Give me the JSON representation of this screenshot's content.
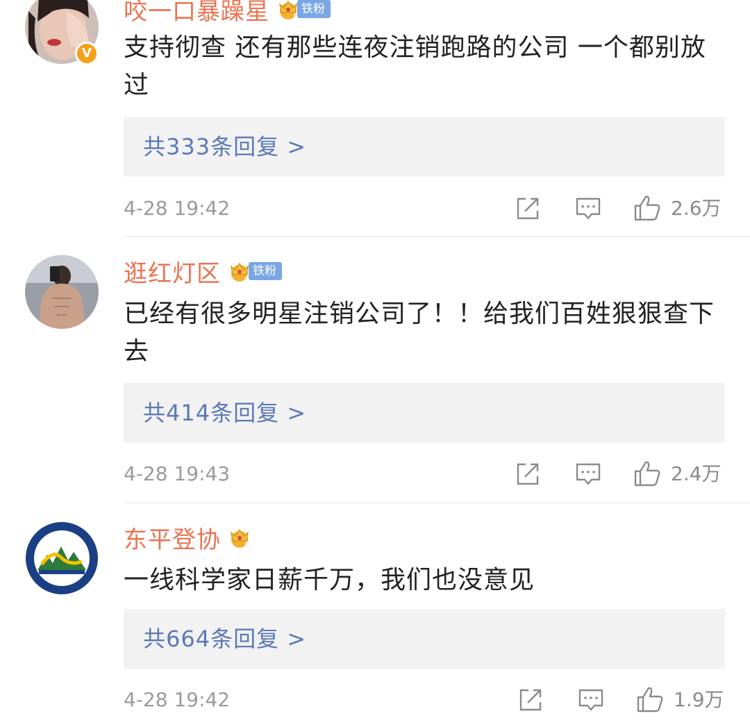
{
  "comments": [
    {
      "username": "咬一口暴躁星",
      "crown_level": "5",
      "fan_badge": "铁粉",
      "verified_mark": "V",
      "text": "支持彻查 还有那些连夜注销跑路的公司 一个都别放过",
      "reply_label": "共333条回复 >",
      "time": "4-28 19:42",
      "likes": "2.6万"
    },
    {
      "username": "逛红灯区",
      "crown_level": "4",
      "fan_badge": "铁粉",
      "text": "已经有很多明星注销公司了！！给我们百姓狠狠查下去",
      "reply_label": "共414条回复 >",
      "time": "4-28 19:43",
      "likes": "2.4万"
    },
    {
      "username": "东平登协",
      "crown_level": "6",
      "text": "一线科学家日薪千万，我们也没意见",
      "reply_label": "共664条回复 >",
      "time": "4-28 19:42",
      "likes": "1.9万"
    }
  ],
  "icons": {
    "share": "share-icon",
    "comment": "comment-icon",
    "like": "thumbs-up-icon"
  },
  "colors": {
    "username": "#eb7350",
    "reply_link": "#5b79b6",
    "reply_bg": "#f2f2f2",
    "meta": "#9a9a9a",
    "crown": "#f2b12d",
    "fan_badge": "#7aa6e3"
  }
}
